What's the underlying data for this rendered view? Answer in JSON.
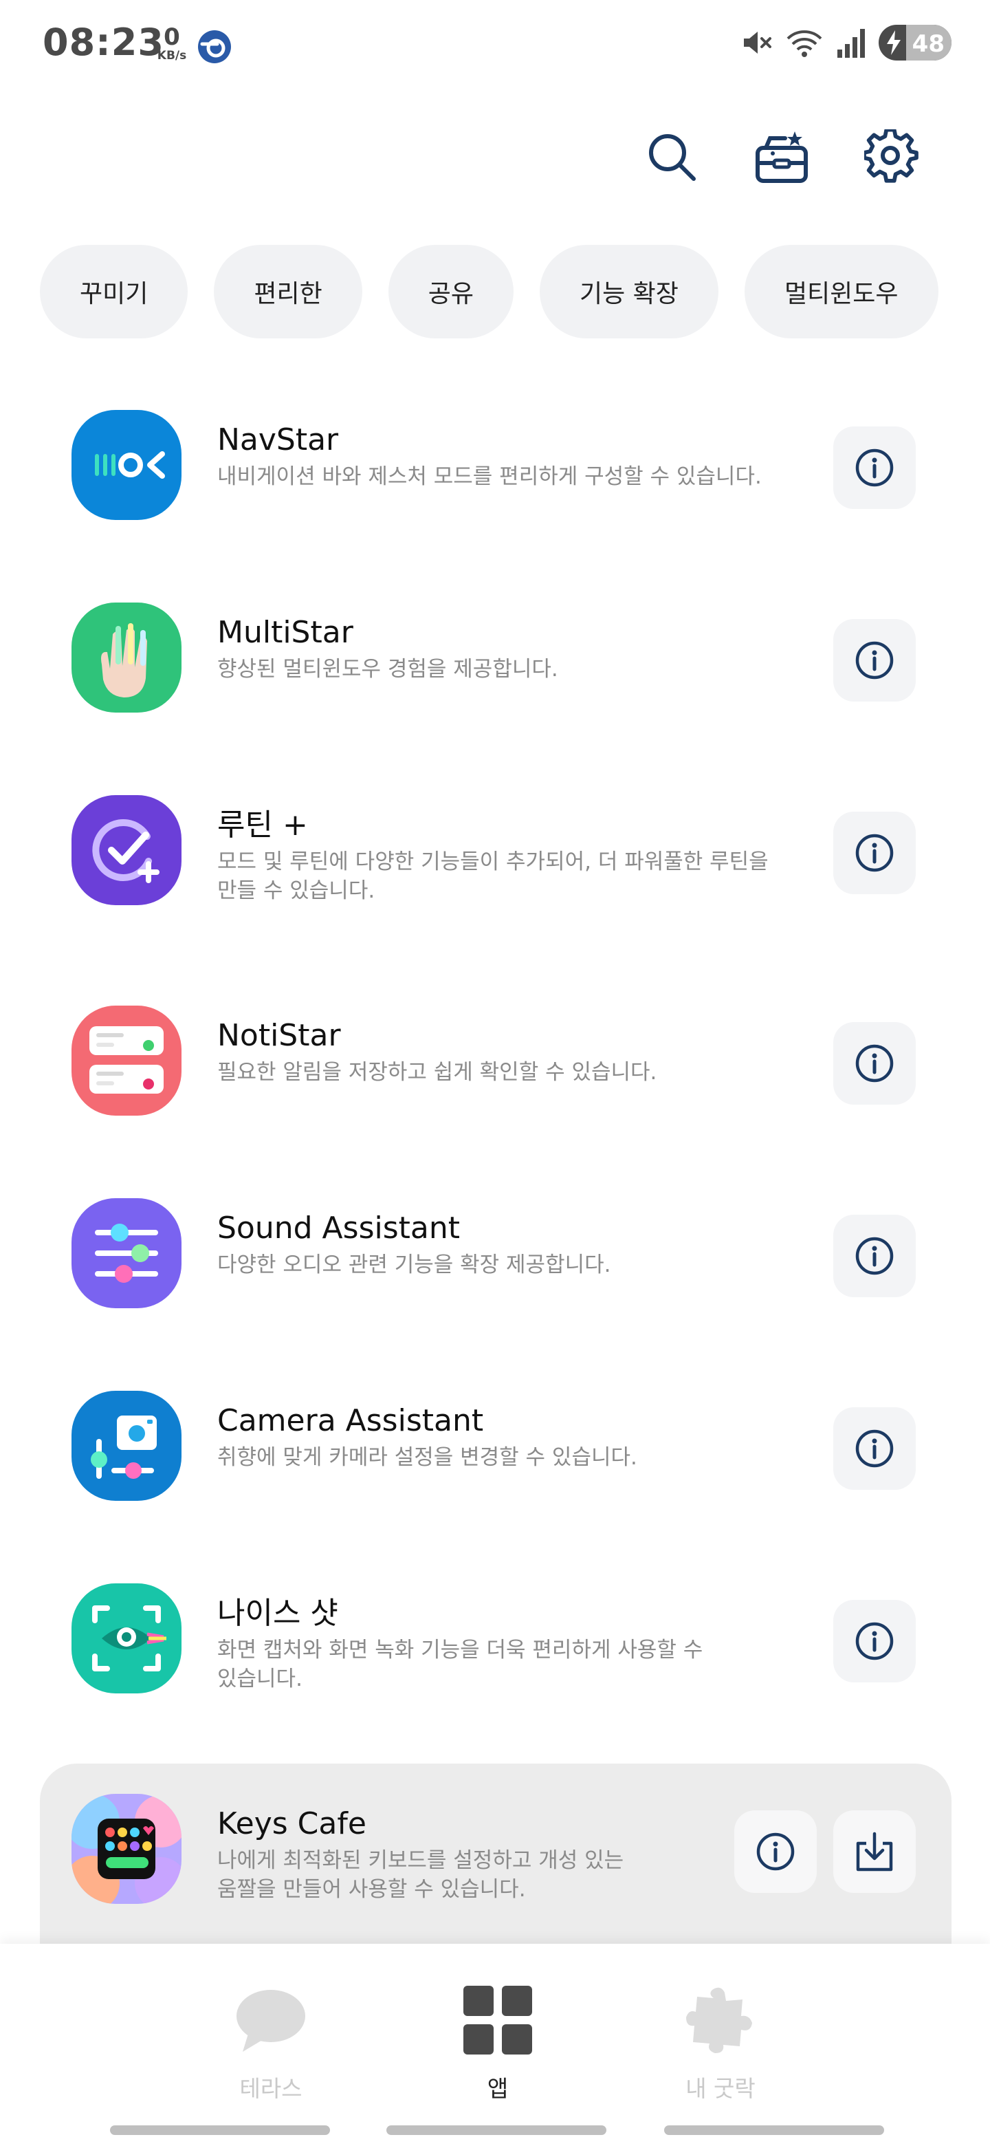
{
  "status_bar": {
    "time": "08:23",
    "net_speed": "0",
    "net_speed_unit": "KB/s",
    "battery": "48"
  },
  "top_actions": {
    "search_icon": "search-icon",
    "store_icon": "store-icon",
    "settings_icon": "gear-icon"
  },
  "chips": [
    "꾸미기",
    "편리한",
    "공유",
    "기능 확장",
    "멀티윈도우"
  ],
  "apps": [
    {
      "title": "NavStar",
      "desc": "내비게이션 바와 제스처 모드를 편리하게 구성할 수 있습니다."
    },
    {
      "title": "MultiStar",
      "desc": "향상된 멀티윈도우 경험을 제공합니다."
    },
    {
      "title": "루틴 +",
      "desc": "모드 및 루틴에 다양한 기능들이 추가되어, 더 파워풀한 루틴을",
      "desc2": "만들 수 있습니다."
    },
    {
      "title": "NotiStar",
      "desc": "필요한 알림을 저장하고 쉽게 확인할 수 있습니다."
    },
    {
      "title": "Sound Assistant",
      "desc": "다양한 오디오 관련 기능을 확장 제공합니다."
    },
    {
      "title": "Camera Assistant",
      "desc": "취향에 맞게 카메라 설정을 변경할 수 있습니다."
    },
    {
      "title": "나이스 샷",
      "desc": "화면 캡처와 화면 녹화 기능을 더욱 편리하게 사용할 수",
      "desc2": "있습니다."
    },
    {
      "title": "Keys Cafe",
      "desc": "나에게 최적화된 키보드를 설정하고 개성 있는",
      "desc2": "움짤을 만들어 사용할 수 있습니다."
    }
  ],
  "bottom_nav": [
    {
      "label": "테라스",
      "icon": "chat-bubble-icon",
      "active": false
    },
    {
      "label": "앱",
      "icon": "grid-icon",
      "active": true
    },
    {
      "label": "내 굿락",
      "icon": "puzzle-icon",
      "active": false
    }
  ],
  "colors": {
    "accent": "#1c3a63",
    "chip_bg": "#f1f2f4",
    "card_bg": "#ececec"
  }
}
